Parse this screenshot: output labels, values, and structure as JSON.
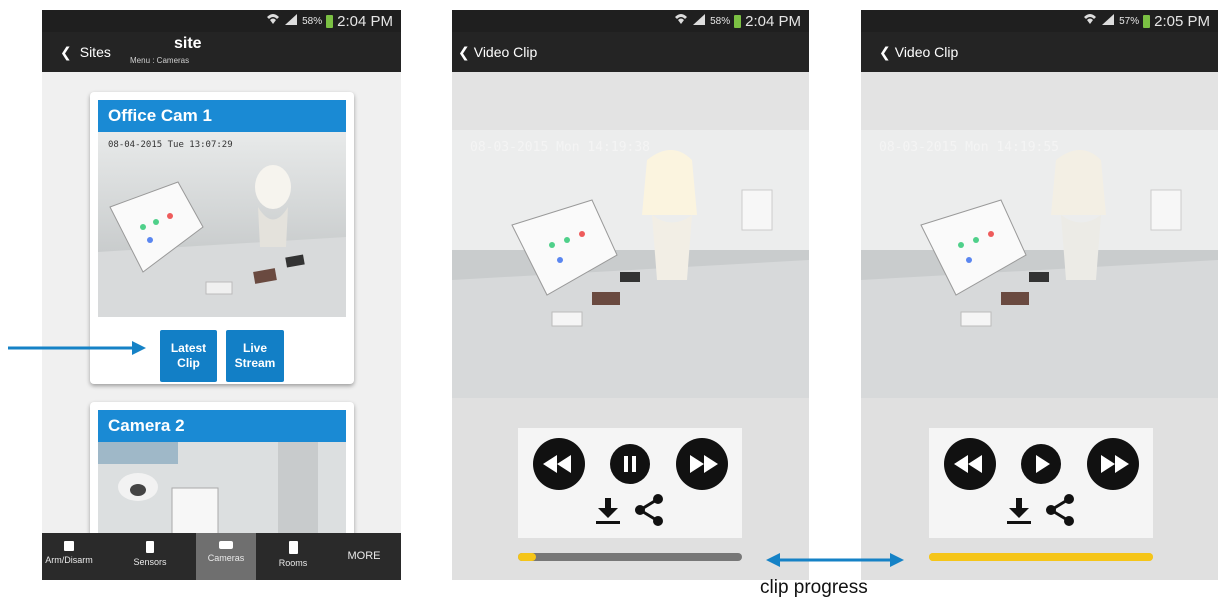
{
  "status": {
    "p1_battery": "58%",
    "p1_time": "2:04 PM",
    "p2_battery": "58%",
    "p2_time": "2:04 PM",
    "p3_battery": "57%",
    "p3_time": "2:05 PM"
  },
  "screen1": {
    "back_label": "Sites",
    "title": "site",
    "subtitle": "Menu : Cameras",
    "cards": [
      {
        "title": "Office Cam 1",
        "timestamp": "08-04-2015 Tue 13:07:29",
        "latest_clip": "Latest Clip",
        "live_stream": "Live Stream"
      },
      {
        "title": "Camera 2"
      }
    ],
    "tabs": [
      "Arm/Disarm",
      "Sensors",
      "Cameras",
      "Rooms",
      "MORE"
    ],
    "active_tab": "Cameras"
  },
  "screen2": {
    "back_label": "Video Clip",
    "timestamp": "08-03-2015 Mon 14:19:38",
    "state": "playing",
    "progress": 0.08
  },
  "screen3": {
    "back_label": "Video Clip",
    "timestamp": "08-03-2015 Mon 14:19:55",
    "state": "paused",
    "progress": 1.0
  },
  "annotation": {
    "caption": "clip progress"
  },
  "colors": {
    "accent_blue": "#1a8ad4",
    "progress_yellow": "#f5c518",
    "arrow_blue": "#1582c6"
  },
  "icons": [
    "wifi-icon",
    "signal-icon",
    "battery-icon",
    "chevron-left-icon",
    "lock-icon",
    "sensor-icon",
    "camera-icon",
    "door-icon",
    "rewind-icon",
    "pause-icon",
    "play-icon",
    "fast-forward-icon",
    "download-icon",
    "share-icon"
  ]
}
